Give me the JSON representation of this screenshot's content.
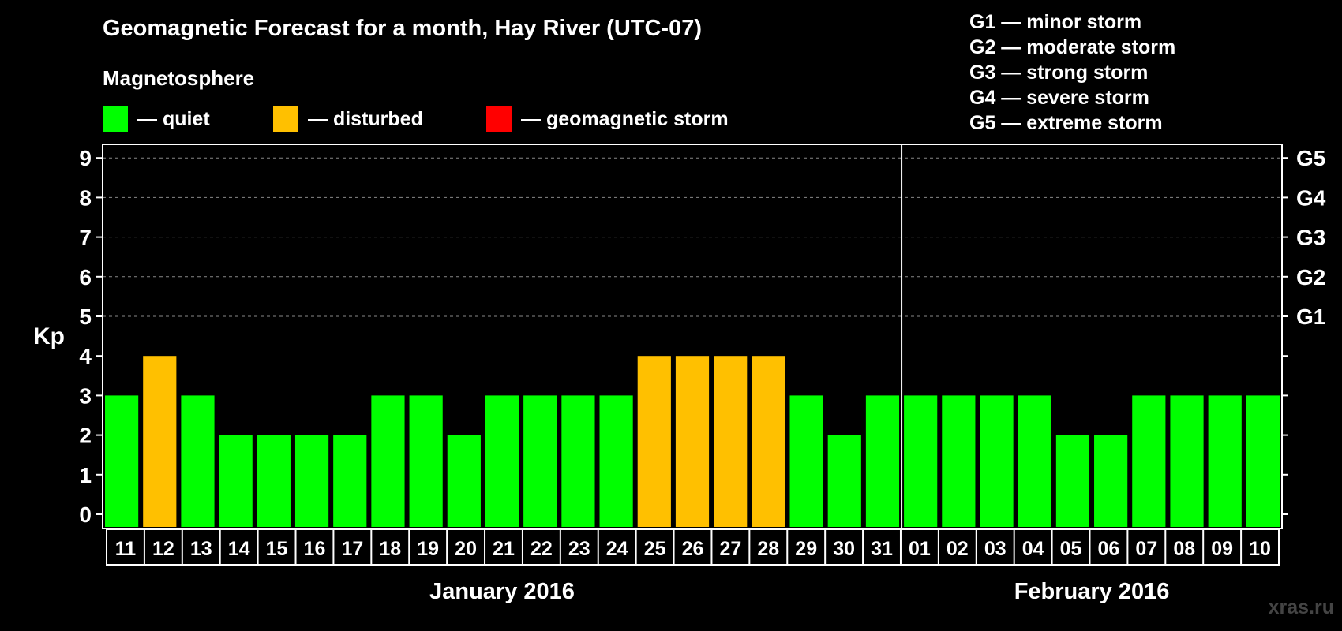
{
  "title": "Geomagnetic Forecast for a month, Hay River (UTC-07)",
  "magnetosphere_label": "Magnetosphere",
  "legend": [
    {
      "label": "— quiet",
      "color": "#00ff00"
    },
    {
      "label": "— disturbed",
      "color": "#ffc000"
    },
    {
      "label": "— geomagnetic storm",
      "color": "#ff0000"
    }
  ],
  "storm_scale": [
    "G1 — minor storm",
    "G2 — moderate storm",
    "G3 — strong storm",
    "G4 — severe storm",
    "G5 — extreme storm"
  ],
  "watermark": "xras.ru",
  "chart_data": {
    "type": "bar",
    "ylabel": "Kp",
    "ylim": [
      0,
      9
    ],
    "yticks": [
      "0",
      "1",
      "2",
      "3",
      "4",
      "5",
      "6",
      "7",
      "8",
      "9"
    ],
    "right_axis_labels": [
      {
        "kp": 5,
        "label": "G1"
      },
      {
        "kp": 6,
        "label": "G2"
      },
      {
        "kp": 7,
        "label": "G3"
      },
      {
        "kp": 8,
        "label": "G4"
      },
      {
        "kp": 9,
        "label": "G5"
      }
    ],
    "grid": "dashed horizontal at Kp 5–9",
    "categories": [
      "11",
      "12",
      "13",
      "14",
      "15",
      "16",
      "17",
      "18",
      "19",
      "20",
      "21",
      "22",
      "23",
      "24",
      "25",
      "26",
      "27",
      "28",
      "29",
      "30",
      "31",
      "01",
      "02",
      "03",
      "04",
      "05",
      "06",
      "07",
      "08",
      "09",
      "10"
    ],
    "values": [
      3,
      4,
      3,
      2,
      2,
      2,
      2,
      3,
      3,
      2,
      3,
      3,
      3,
      3,
      4,
      4,
      4,
      4,
      3,
      2,
      3,
      3,
      3,
      3,
      3,
      2,
      2,
      3,
      3,
      3,
      3
    ],
    "months": [
      {
        "label": "January 2016",
        "from_index": 0,
        "to_index": 20
      },
      {
        "label": "February 2016",
        "from_index": 21,
        "to_index": 30
      }
    ],
    "color_rule": {
      "quiet_max": 3,
      "disturbed_max": 4,
      "quiet": "#00ff00",
      "disturbed": "#ffc000",
      "storm": "#ff0000"
    }
  }
}
